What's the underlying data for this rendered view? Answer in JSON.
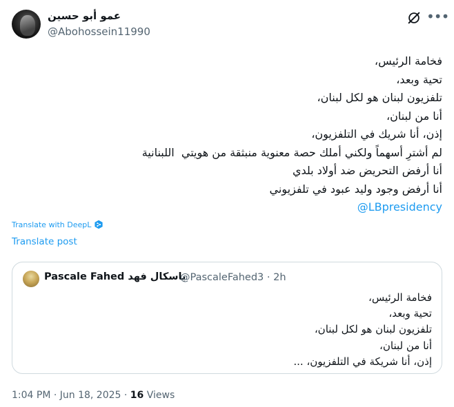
{
  "author": {
    "display_name": "عمو أبو حسين",
    "handle": "@Abohossein11990"
  },
  "header_icons": [
    "grok-icon",
    "more-icon"
  ],
  "tweet": {
    "lines": [
      "فخامة الرئيس،",
      "تحية وبعد،",
      "تلفزيون لبنان هو لكل لبنان،",
      "أنا من لبنان،",
      "إذن، أنا شريك في التلفزيون،",
      "لم أشترِ أسهماً ولكني أملك حصة معنوية منبثقة من هويتي  اللبنانية",
      "أنا أرفض التحريض ضد أولاد بلدي",
      "أنا أرفض وجود وليد عبود في تلفزيوني"
    ],
    "mention": "@LBpresidency"
  },
  "translate": {
    "deepl_label": "Translate with DeepL",
    "post_label": "Translate post"
  },
  "quote": {
    "display_name": "Pascale Fahed باسكال فهد",
    "handle_time": "@PascaleFahed3 · 2h",
    "lines": [
      "فخامة الرئيس،",
      "تحية وبعد،",
      "تلفزيون لبنان هو لكل لبنان،",
      "أنا من لبنان،",
      "إذن، أنا شريكة في التلفزيون، ..."
    ]
  },
  "meta": {
    "datetime": "1:04 PM · Jun 18, 2025 · ",
    "views_count": "16",
    "views_label": " Views"
  },
  "colors": {
    "accent": "#1d9bf0",
    "text": "#0f1419",
    "secondary": "#536471",
    "border": "#cfd9de"
  }
}
